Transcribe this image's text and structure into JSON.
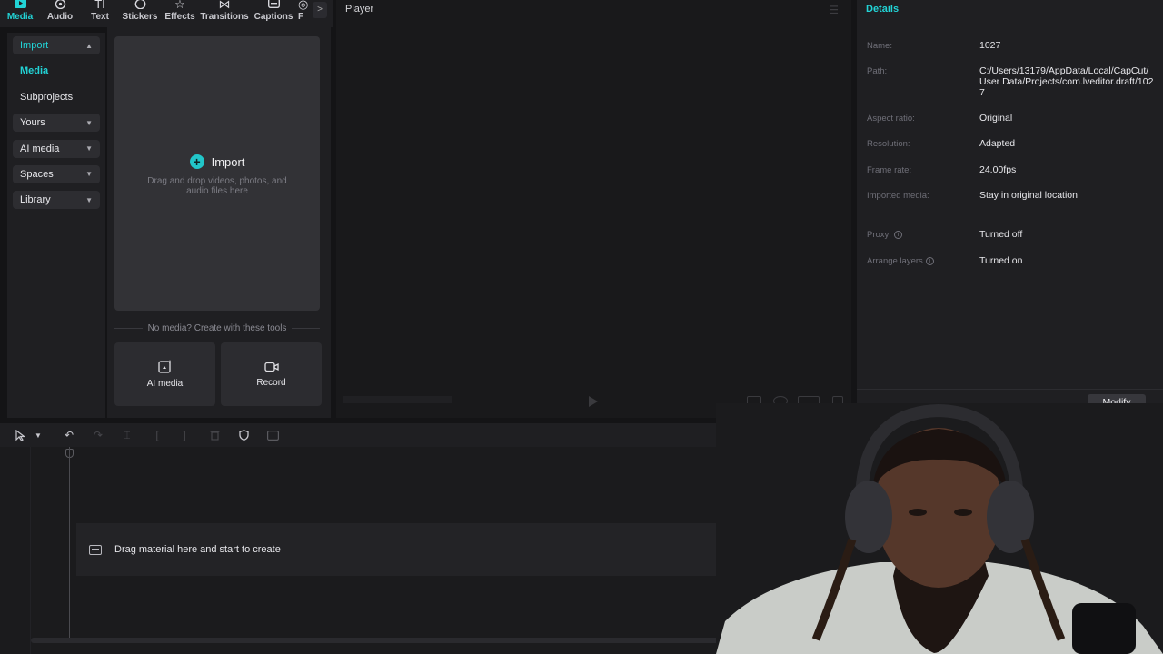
{
  "toolbar": {
    "tabs": [
      {
        "label": "Media",
        "icon": "media-icon"
      },
      {
        "label": "Audio",
        "icon": "audio-icon"
      },
      {
        "label": "Text",
        "icon": "text-icon"
      },
      {
        "label": "Stickers",
        "icon": "stickers-icon"
      },
      {
        "label": "Effects",
        "icon": "effects-icon"
      },
      {
        "label": "Transitions",
        "icon": "transitions-icon"
      },
      {
        "label": "Captions",
        "icon": "captions-icon"
      },
      {
        "label": "F",
        "icon": "filters-icon"
      }
    ],
    "more_label": ">"
  },
  "leftnav": {
    "import": "Import",
    "media": "Media",
    "subprojects": "Subprojects",
    "yours": "Yours",
    "ai_media": "AI media",
    "spaces": "Spaces",
    "library": "Library"
  },
  "mediapane": {
    "import_label": "Import",
    "import_hint": "Drag and drop videos, photos, and audio files here",
    "no_media": "No media? Create with these tools",
    "card_ai": "AI media",
    "card_record": "Record"
  },
  "player": {
    "title": "Player"
  },
  "details": {
    "title": "Details",
    "rows": [
      {
        "key": "Name:",
        "value": "1027"
      },
      {
        "key": "Path:",
        "value": "C:/Users/13179/AppData/Local/CapCut/User Data/Projects/com.lveditor.draft/1027"
      },
      {
        "key": "Aspect ratio:",
        "value": "Original"
      },
      {
        "key": "Resolution:",
        "value": "Adapted"
      },
      {
        "key": "Frame rate:",
        "value": "24.00fps"
      },
      {
        "key": "Imported media:",
        "value": "Stay in original location"
      },
      {
        "key": "Proxy:",
        "value": "Turned off"
      },
      {
        "key": "Arrange layers",
        "value": "Turned on"
      }
    ],
    "modify_label": "Modify"
  },
  "timeline": {
    "drop_hint": "Drag material here and start to create"
  },
  "colors": {
    "accent": "#22d3d6",
    "panel": "#1f1f22",
    "background": "#141416"
  }
}
